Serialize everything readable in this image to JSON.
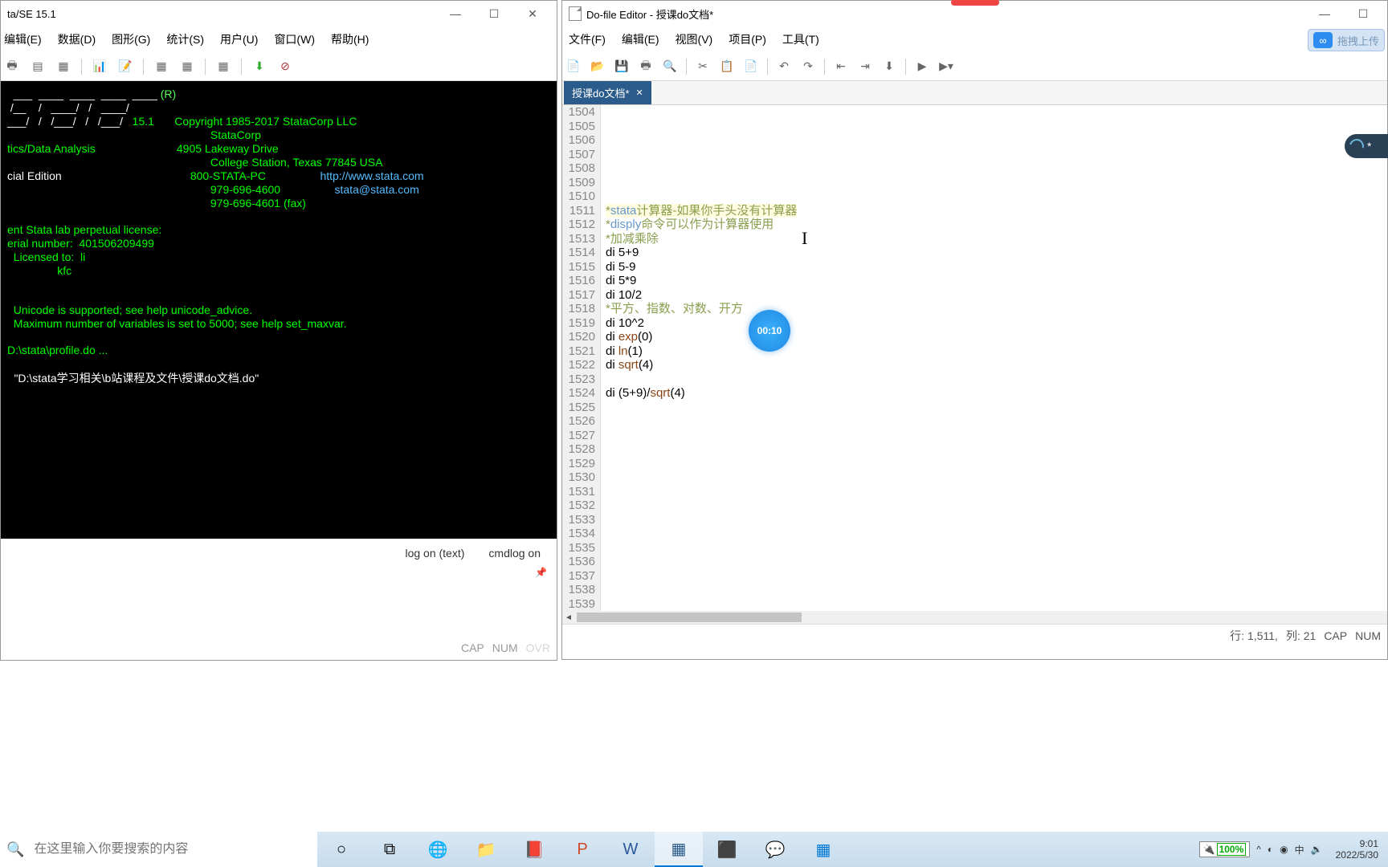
{
  "stata": {
    "title": "ta/SE 15.1",
    "menu": [
      "编辑(E)",
      "数据(D)",
      "图形(G)",
      "统计(S)",
      "用户(U)",
      "窗口(W)",
      "帮助(H)"
    ],
    "console": {
      "reg": "(R)",
      "version": "15.1",
      "copyright": "Copyright 1985-2017 StataCorp LLC",
      "company": "StataCorp",
      "subtitle": "tics/Data Analysis",
      "address1": "4905 Lakeway Drive",
      "edition": "cial Edition",
      "address2": "College Station, Texas 77845 USA",
      "phone1": "800-STATA-PC",
      "url": "http://www.stata.com",
      "phone2": "979-696-4600",
      "email": "stata@stata.com",
      "fax": "979-696-4601 (fax)",
      "license1": "ent Stata lab perpetual license:",
      "serial": "erial number:  401506209499",
      "licensed_to": "  Licensed to:  li",
      "licensed_org": "                kfc",
      "note1": "  Unicode is supported; see help unicode_advice.",
      "note2": "  Maximum number of variables is set to 5000; see help set_maxvar.",
      "profile": "D:\\stata\\profile.do ...",
      "dofile": "\"D:\\stata学习相关\\b站课程及文件\\授课do文档.do\""
    },
    "bottom": {
      "log_on_text": "log on (text)",
      "cmdlog_on": "cmdlog on"
    },
    "status": {
      "cap": "CAP",
      "num": "NUM",
      "ovr": "OVR"
    }
  },
  "dofile": {
    "title": "Do-file Editor - 授课do文档*",
    "menu": [
      "文件(F)",
      "编辑(E)",
      "视图(V)",
      "项目(P)",
      "工具(T)"
    ],
    "tab_name": "授课do文档*",
    "lines_start": 1504,
    "lines_end": 1539,
    "code": {
      "l1511": "*stata计算器-如果你手头没有计算器",
      "l1512": "*disply命令可以作为计算器使用",
      "l1513": "*加减乘除",
      "l1514": " di 5+9",
      "l1515": " di 5-9",
      "l1516": " di 5*9",
      "l1517": " di 10/2",
      "l1518": "*平方、指数、对数、开方",
      "l1519": " di 10^2",
      "l1520": " di exp(0)",
      "l1521": " di ln(1)",
      "l1522": " di sqrt(4)",
      "l1524": "di (5+9)/sqrt(4)"
    },
    "status": {
      "line": "行: 1,511,",
      "col": "列:   21",
      "cap": "CAP",
      "num": "NUM"
    }
  },
  "timer": "00:10",
  "cloud_upload": "拖拽上传",
  "side_tab_char": "*",
  "taskbar": {
    "search_placeholder": "在这里输入你要搜索的内容",
    "battery": "100%",
    "time": "9:01",
    "date": "2022/5/30"
  }
}
